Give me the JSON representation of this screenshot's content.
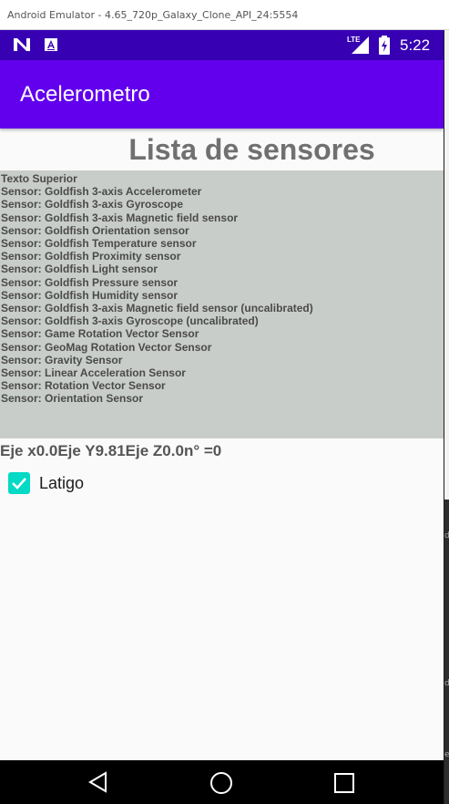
{
  "window": {
    "title": "Android Emulator - 4.65_720p_Galaxy_Clone_API_24:5554"
  },
  "status_bar": {
    "time": "5:22",
    "network_label": "LTE",
    "icons": [
      "n-logo-icon",
      "sim-a-icon",
      "lte-signal-icon",
      "battery-charging-icon"
    ]
  },
  "app_bar": {
    "title": "Acelerometro"
  },
  "main": {
    "heading": "Lista de sensores",
    "sensor_list": [
      "Texto Superior",
      "Sensor: Goldfish 3-axis Accelerometer",
      "Sensor: Goldfish 3-axis Gyroscope",
      "Sensor: Goldfish 3-axis Magnetic field sensor",
      "Sensor: Goldfish Orientation sensor",
      "Sensor: Goldfish Temperature sensor",
      "Sensor: Goldfish Proximity sensor",
      "Sensor: Goldfish Light sensor",
      "Sensor: Goldfish Pressure sensor",
      "Sensor: Goldfish Humidity sensor",
      "Sensor: Goldfish 3-axis Magnetic field sensor (uncalibrated)",
      "Sensor: Goldfish 3-axis Gyroscope (uncalibrated)",
      "Sensor: Game Rotation Vector Sensor",
      "Sensor: GeoMag Rotation Vector Sensor",
      "Sensor: Gravity Sensor",
      "Sensor: Linear Acceleration Sensor",
      "Sensor: Rotation Vector Sensor",
      "Sensor: Orientation Sensor"
    ],
    "axis_readout": "Eje x0.0Eje Y9.81Eje Z0.0n° =0",
    "checkbox": {
      "label": "Latigo",
      "checked": true
    }
  },
  "nav_bar": {
    "buttons": [
      "back-icon",
      "home-icon",
      "recents-icon"
    ]
  },
  "colors": {
    "status_bar": "#3700b3",
    "app_bar": "#6200ee",
    "checkbox": "#03dac5",
    "sensor_box": "#c9cdc9"
  }
}
